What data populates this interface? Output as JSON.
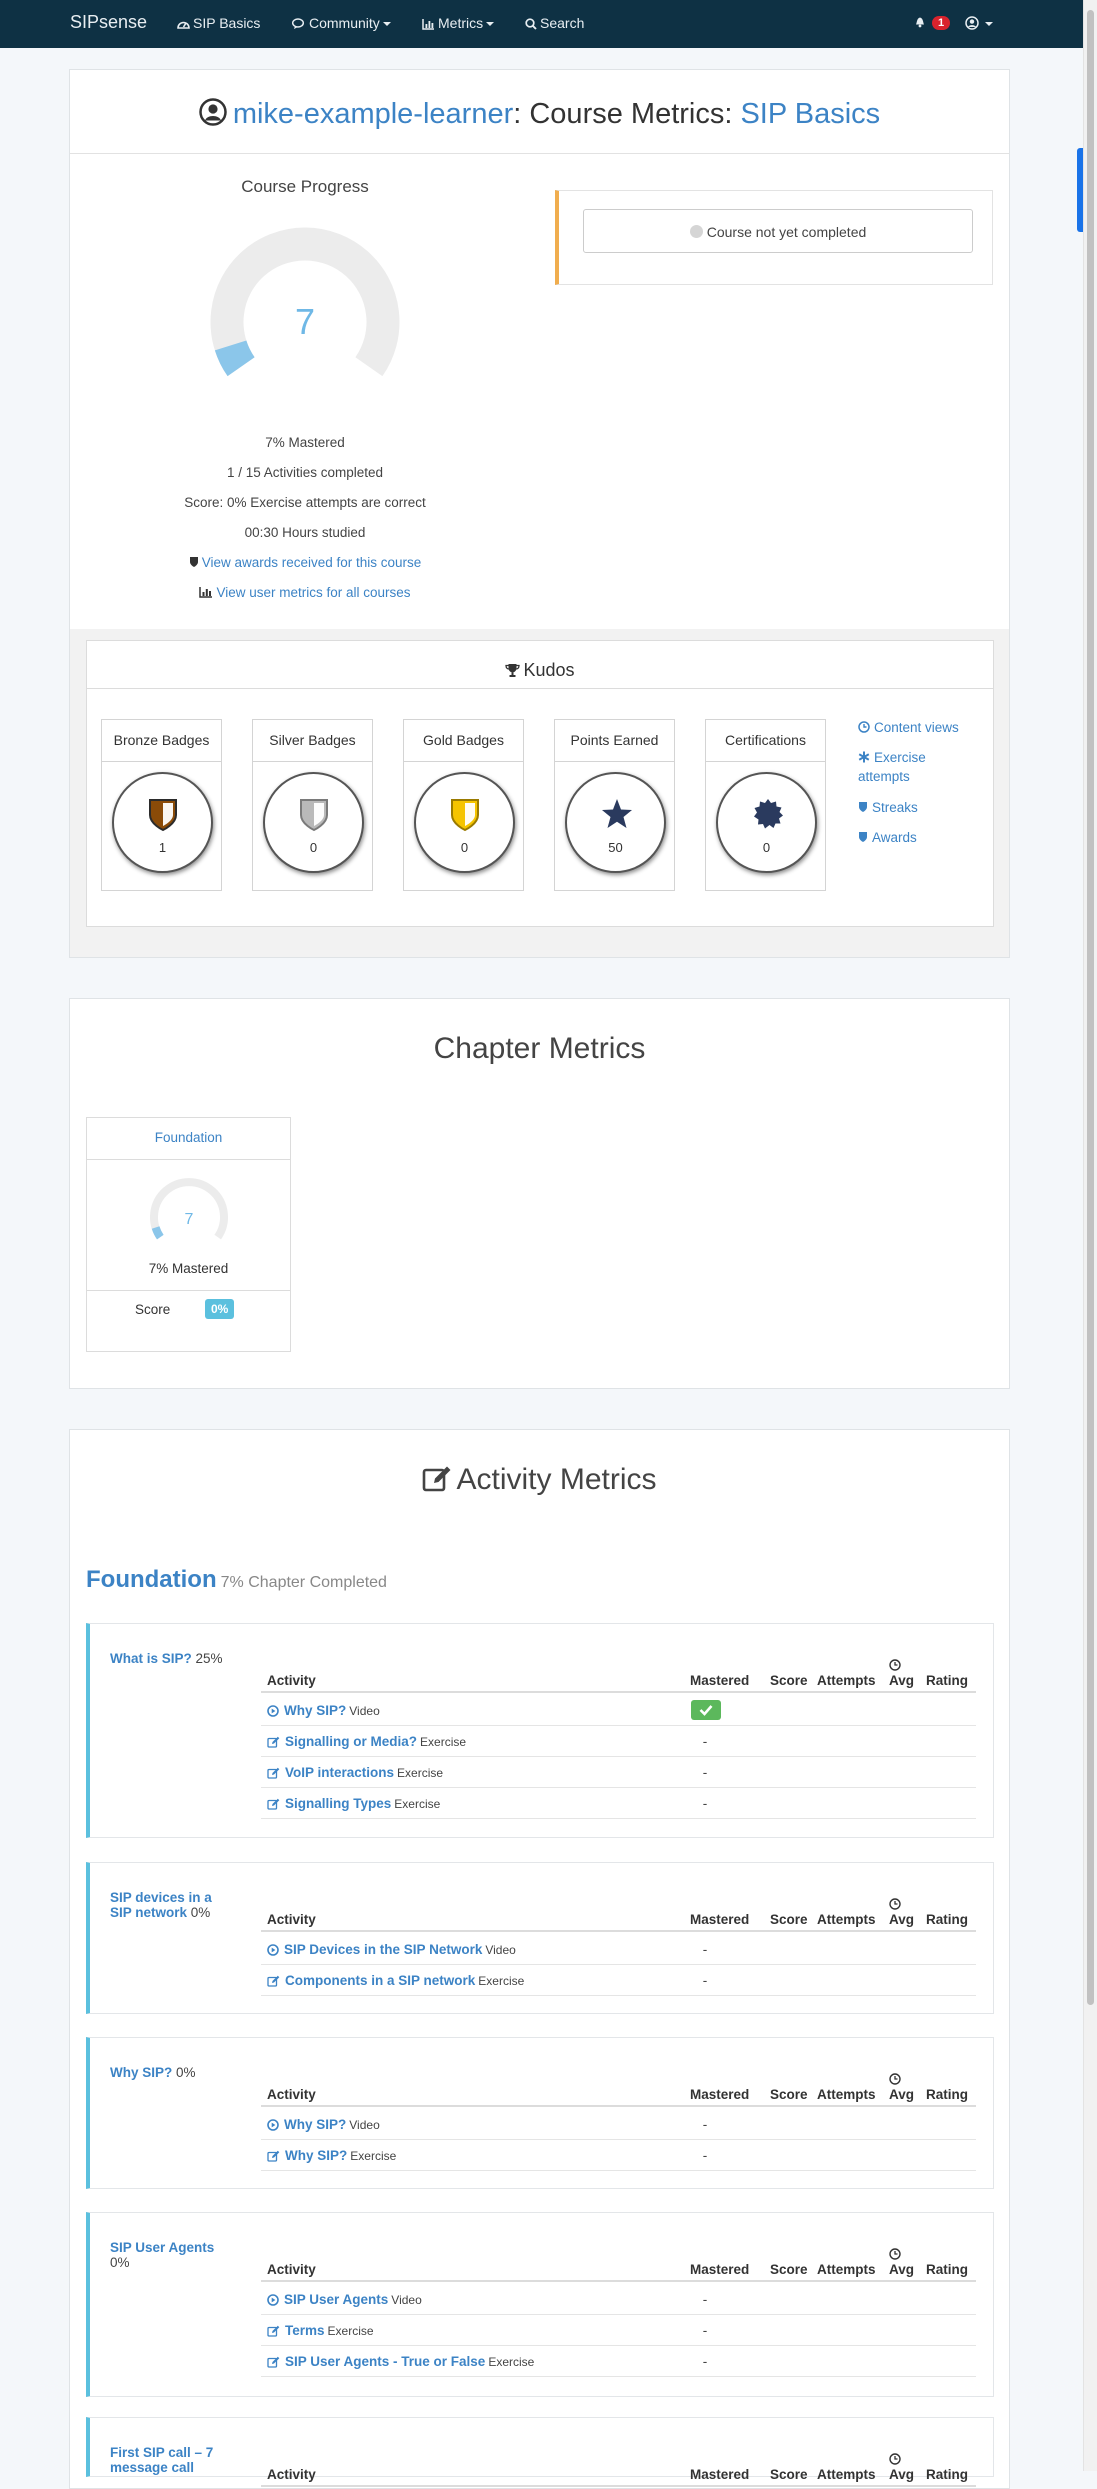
{
  "navbar": {
    "brand": "SIPsense",
    "items": [
      {
        "icon": "tachometer-icon",
        "label": "SIP Basics"
      },
      {
        "icon": "comments-icon",
        "label": "Community"
      },
      {
        "icon": "bar-chart-icon",
        "label": "Metrics"
      },
      {
        "icon": "search-icon",
        "label": "Search"
      }
    ],
    "notification_count": "1"
  },
  "header": {
    "user_name": "mike-example-learner",
    "middle": ": Course Metrics: ",
    "course": "SIP Basics"
  },
  "course_progress": {
    "title": "Course Progress",
    "gauge_value": "7",
    "mastered_fraction": 0.07,
    "mastered_text": "7% Mastered",
    "activities_text": "1 / 15 Activities completed",
    "score_text": "Score: 0% Exercise attempts are correct",
    "hours_text": "00:30 Hours studied",
    "awards_link": "View awards received for this course",
    "metrics_link": "View user metrics for all courses"
  },
  "completion": {
    "text": "Course not yet completed"
  },
  "kudos": {
    "title": "Kudos",
    "badges": [
      {
        "title": "Bronze Badges",
        "count": "1",
        "icon": "shield-icon",
        "color": "#8a4b08"
      },
      {
        "title": "Silver Badges",
        "count": "0",
        "icon": "shield-icon",
        "color": "#b9b9b9"
      },
      {
        "title": "Gold Badges",
        "count": "0",
        "icon": "shield-icon",
        "color": "#f5c400"
      },
      {
        "title": "Points Earned",
        "count": "50",
        "icon": "star-icon",
        "color": "#2a3a5e"
      },
      {
        "title": "Certifications",
        "count": "0",
        "icon": "certificate-icon",
        "color": "#2a3a5e"
      }
    ],
    "links": [
      {
        "icon": "clock-icon",
        "label": "Content views"
      },
      {
        "icon": "asterisk-icon",
        "label": "Exercise attempts"
      },
      {
        "icon": "shield-icon",
        "label": "Streaks"
      },
      {
        "icon": "shield-icon",
        "label": "Awards"
      }
    ]
  },
  "chapter_metrics": {
    "title": "Chapter Metrics",
    "chapters": [
      {
        "name": "Foundation",
        "gauge_value": "7",
        "mastered_fraction": 0.07,
        "mastered_text": "7% Mastered",
        "score_label": "Score",
        "score_value": "0%"
      }
    ]
  },
  "activity_metrics": {
    "title": "Activity Metrics",
    "chapter_name": "Foundation",
    "chapter_status": "7% Chapter Completed",
    "columns": [
      "Activity",
      "Mastered",
      "Score",
      "Attempts",
      "Avg",
      "Rating"
    ],
    "topics": [
      {
        "name": "What is SIP?",
        "percent": "25%",
        "rows": [
          {
            "icon": "play-icon",
            "name": "Why SIP?",
            "type": "Video",
            "mastered": "check"
          },
          {
            "icon": "edit-icon",
            "name": "Signalling or Media?",
            "type": "Exercise",
            "mastered": "-"
          },
          {
            "icon": "edit-icon",
            "name": "VoIP interactions",
            "type": "Exercise",
            "mastered": "-"
          },
          {
            "icon": "edit-icon",
            "name": "Signalling Types",
            "type": "Exercise",
            "mastered": "-"
          }
        ]
      },
      {
        "name": "SIP devices in a SIP network",
        "percent": "0%",
        "rows": [
          {
            "icon": "play-icon",
            "name": "SIP Devices in the SIP Network",
            "type": "Video",
            "mastered": "-"
          },
          {
            "icon": "edit-icon",
            "name": "Components in a SIP network",
            "type": "Exercise",
            "mastered": "-"
          }
        ]
      },
      {
        "name": "Why SIP?",
        "percent": "0%",
        "rows": [
          {
            "icon": "play-icon",
            "name": "Why SIP?",
            "type": "Video",
            "mastered": "-"
          },
          {
            "icon": "edit-icon",
            "name": "Why SIP?",
            "type": "Exercise",
            "mastered": "-"
          }
        ]
      },
      {
        "name": "SIP User Agents",
        "percent": "0%",
        "rows": [
          {
            "icon": "play-icon",
            "name": "SIP User Agents",
            "type": "Video",
            "mastered": "-"
          },
          {
            "icon": "edit-icon",
            "name": "Terms",
            "type": "Exercise",
            "mastered": "-"
          },
          {
            "icon": "edit-icon",
            "name": "SIP User Agents - True or False",
            "type": "Exercise",
            "mastered": "-"
          }
        ]
      },
      {
        "name": "First SIP call – 7 message call",
        "percent": "",
        "rows": []
      }
    ]
  }
}
